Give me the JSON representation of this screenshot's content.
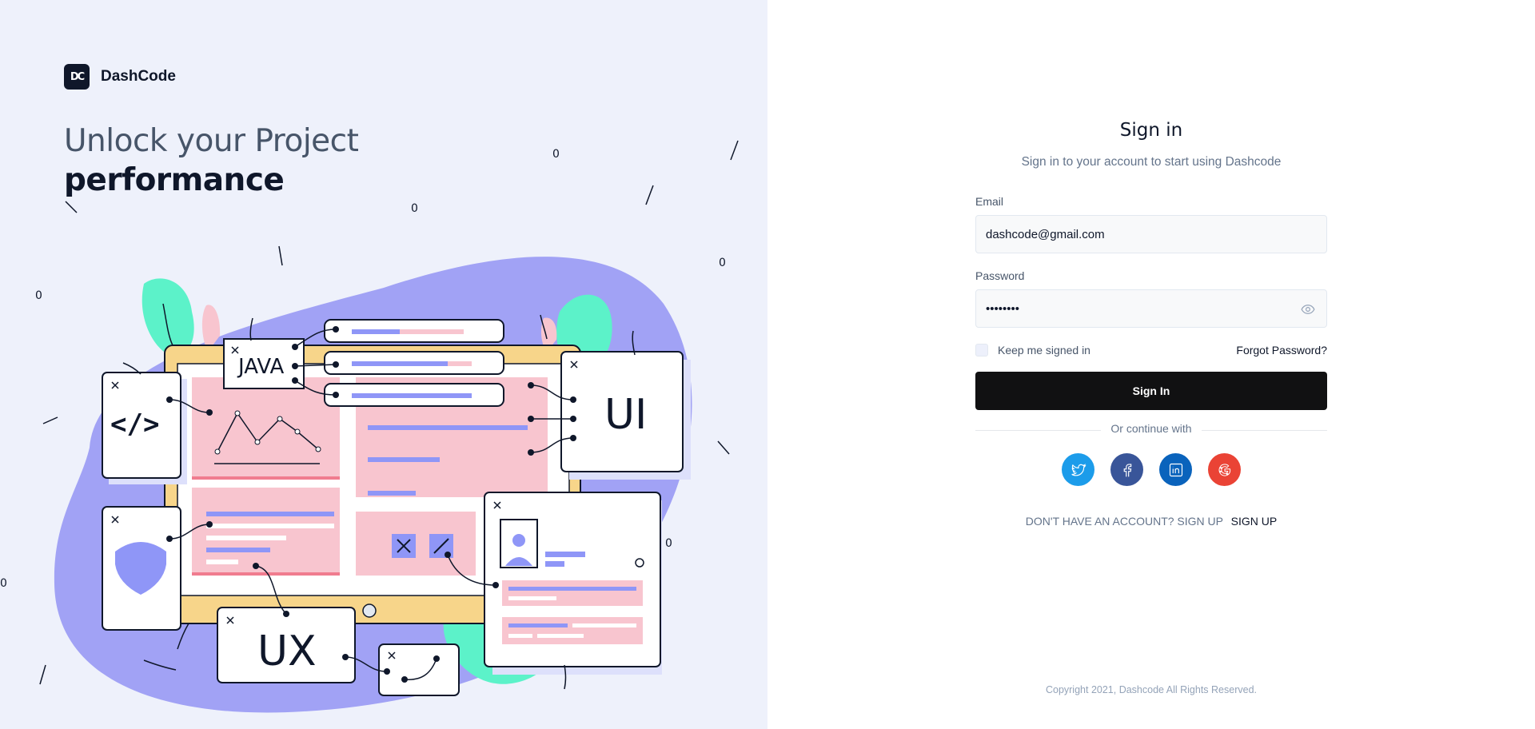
{
  "brand": {
    "logo_text": "DC",
    "name": "DashCode"
  },
  "headline": {
    "line1": "Unlock your Project",
    "line2": "performance"
  },
  "illustration": {
    "labels": {
      "java": "JAVA",
      "ui": "UI",
      "ux": "UX",
      "code": "</>"
    },
    "floating_zeros": [
      "0",
      "0",
      "0",
      "0",
      "0",
      "0"
    ]
  },
  "form": {
    "title": "Sign in",
    "subtitle": "Sign in to your account to start using Dashcode",
    "email": {
      "label": "Email",
      "value": "dashcode@gmail.com"
    },
    "password": {
      "label": "Password",
      "value": "dashcode"
    },
    "keep_signed_in": "Keep me signed in",
    "forgot_password": "Forgot Password?",
    "submit_label": "Sign In",
    "continue_with": "Or continue with",
    "socials": [
      {
        "name": "twitter",
        "color": "#1c9cea"
      },
      {
        "name": "facebook",
        "color": "#395599"
      },
      {
        "name": "linkedin",
        "color": "#0a63bc"
      },
      {
        "name": "google",
        "color": "#ea4335"
      }
    ],
    "signup_prompt": "DON'T HAVE AN ACCOUNT? SIGN UP",
    "signup_link": "SIGN UP"
  },
  "footer": {
    "copyright": "Copyright 2021, Dashcode All Rights Reserved."
  },
  "colors": {
    "left_bg": "#eef1fb",
    "blob_purple": "#a1a2f5",
    "blob_mint": "#5cf2c9",
    "pink_panel": "#f8c5cf",
    "accent_blue": "#8f96f7",
    "dark": "#0f172a",
    "button_bg": "#111112"
  }
}
